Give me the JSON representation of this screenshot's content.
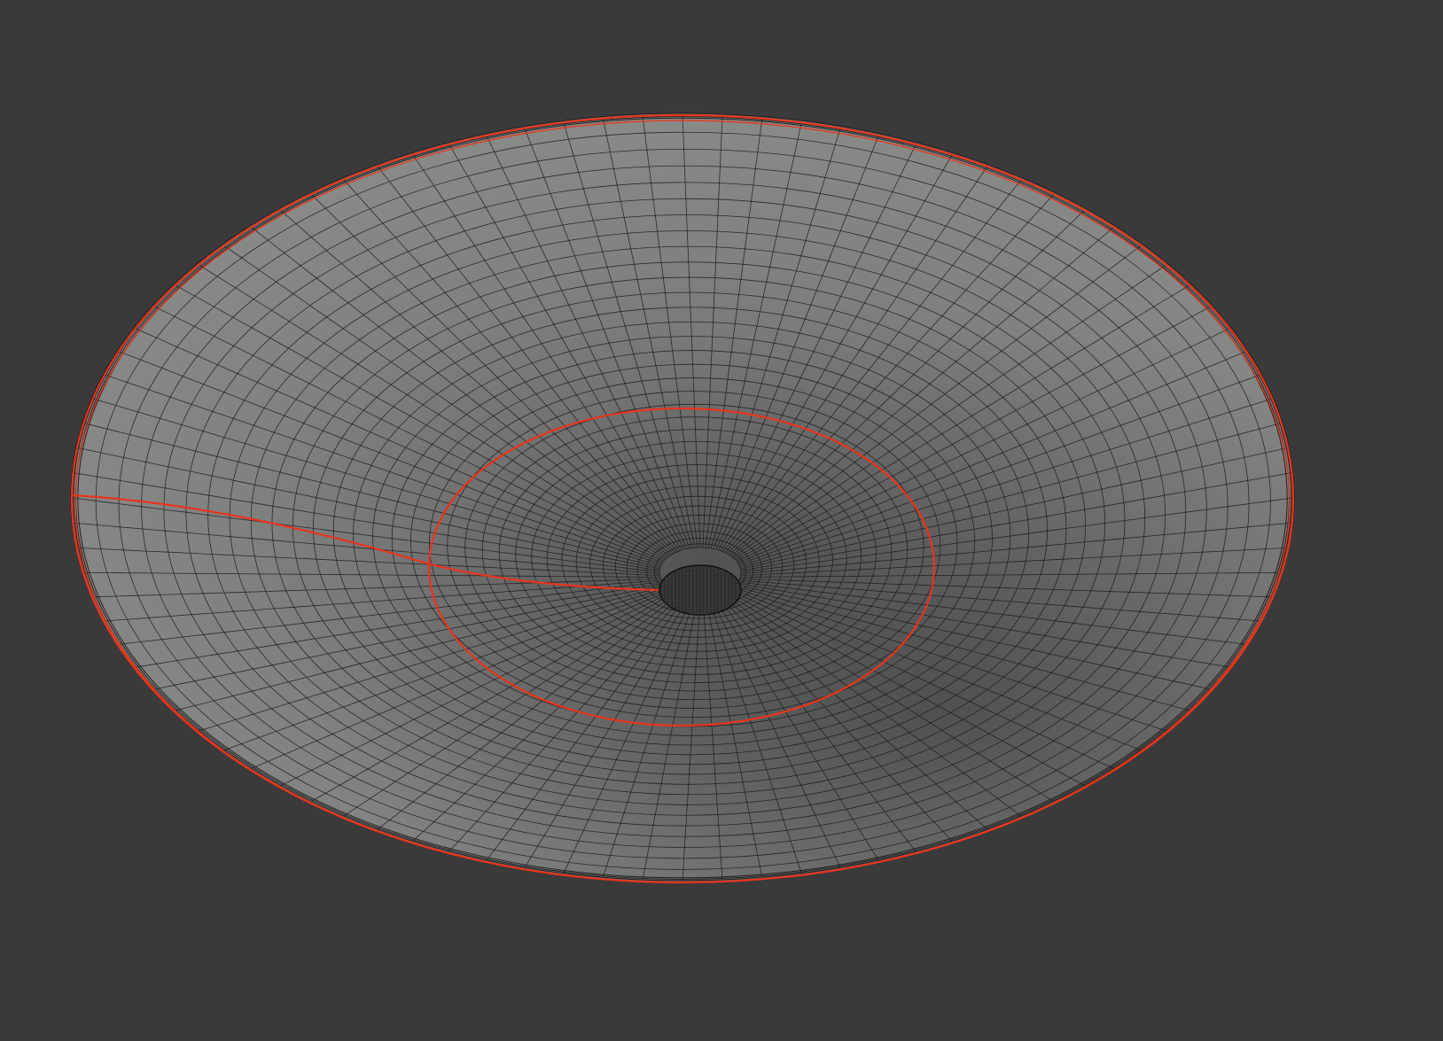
{
  "viewport": {
    "background_color": "#3a3a3a",
    "mode": "edit-mode-wireframe-overlay"
  },
  "mesh": {
    "object": "dish-bowl",
    "surface_color": "#7d7f7e",
    "surface_shadow_color": "#4a4b4a",
    "wire_color": "#1a1a1a",
    "seam_color": "#e8341c",
    "radial_segments": 96,
    "ring_loops": 34,
    "seams": [
      "outer-rim-seam",
      "inner-ring-seam",
      "radial-seam"
    ]
  }
}
